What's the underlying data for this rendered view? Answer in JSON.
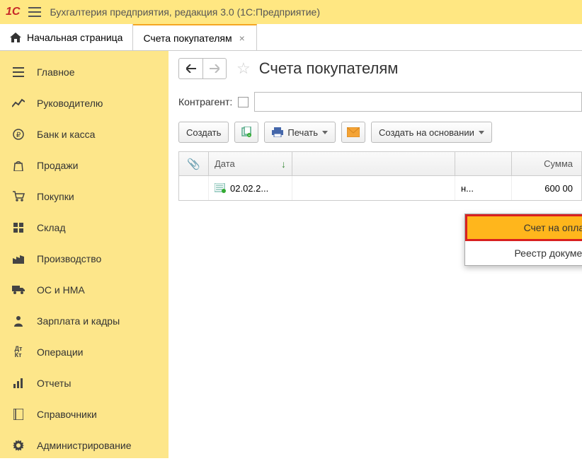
{
  "app": {
    "title": "Бухгалтерия предприятия, редакция 3.0   (1С:Предприятие)"
  },
  "tabs": {
    "home": "Начальная страница",
    "active": "Счета покупателям"
  },
  "sidebar": [
    {
      "label": "Главное",
      "icon": "menu"
    },
    {
      "label": "Руководителю",
      "icon": "chart"
    },
    {
      "label": "Банк и касса",
      "icon": "ruble"
    },
    {
      "label": "Продажи",
      "icon": "bag"
    },
    {
      "label": "Покупки",
      "icon": "cart"
    },
    {
      "label": "Склад",
      "icon": "grid"
    },
    {
      "label": "Производство",
      "icon": "factory"
    },
    {
      "label": "ОС и НМА",
      "icon": "truck"
    },
    {
      "label": "Зарплата и кадры",
      "icon": "person"
    },
    {
      "label": "Операции",
      "icon": "dtkt"
    },
    {
      "label": "Отчеты",
      "icon": "bars"
    },
    {
      "label": "Справочники",
      "icon": "book"
    },
    {
      "label": "Администрирование",
      "icon": "gear"
    }
  ],
  "page": {
    "title": "Счета покупателям",
    "filter_label": "Контрагент:",
    "toolbar": {
      "create": "Создать",
      "print": "Печать",
      "create_based": "Создать на основании"
    },
    "columns": {
      "date": "Дата",
      "sum": "Сумма"
    },
    "row": {
      "date": "02.02.2...",
      "ctr_partial": "н...",
      "sum": "600 00"
    },
    "dropdown": {
      "item1": "Счет на оплату",
      "item2": "Реестр документов"
    }
  }
}
